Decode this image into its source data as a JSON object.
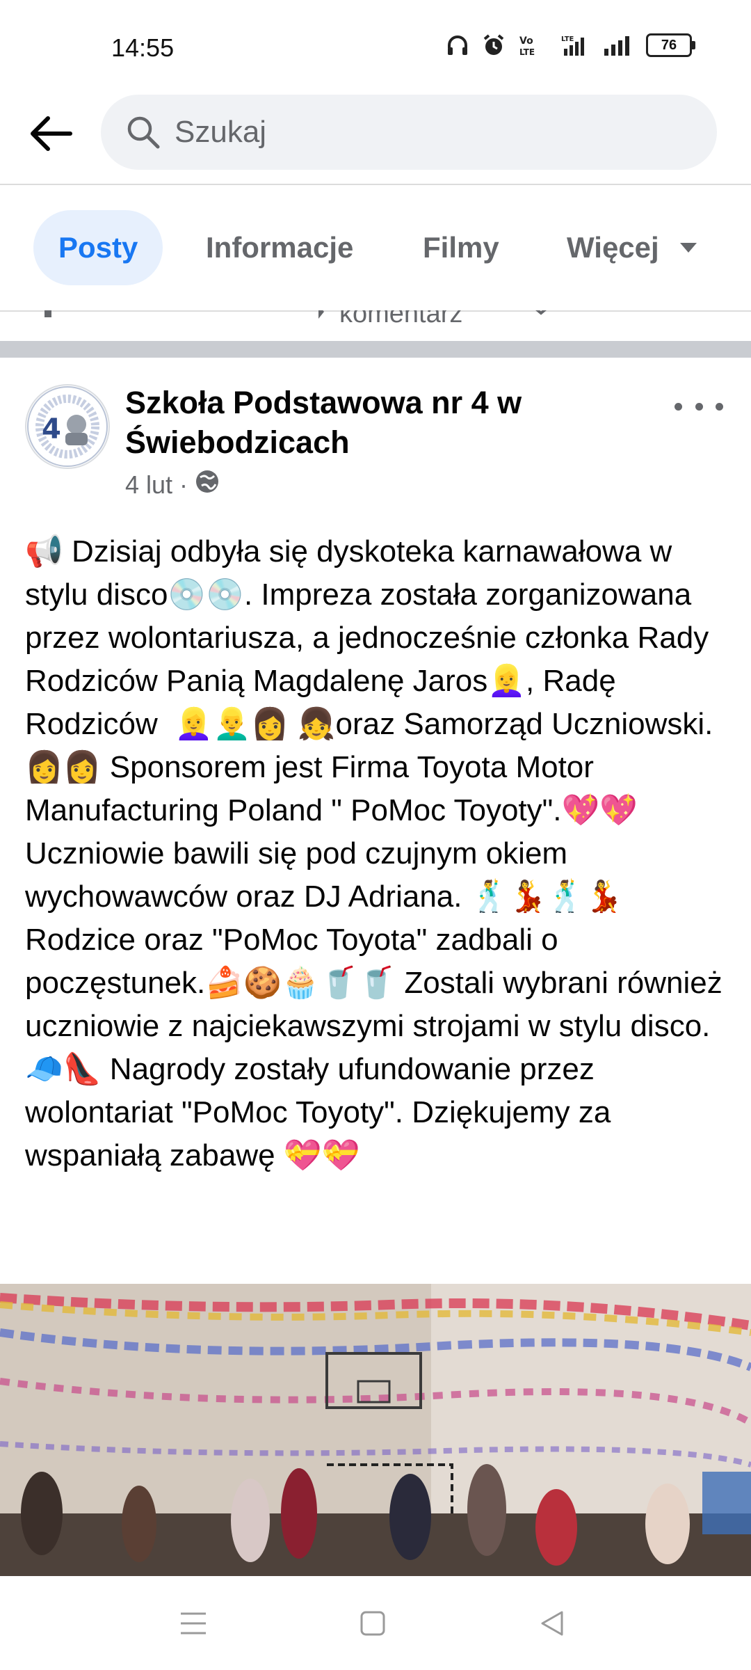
{
  "status_bar": {
    "time": "14:55",
    "battery": "76"
  },
  "search": {
    "placeholder": "Szukaj"
  },
  "tabs": [
    {
      "label": "Posty",
      "active": true
    },
    {
      "label": "Informacje",
      "active": false
    },
    {
      "label": "Filmy",
      "active": false
    },
    {
      "label": "Więcej",
      "active": false
    }
  ],
  "previous_post": {
    "comment_label": "komentarz"
  },
  "post": {
    "author": "Szkoła Podstawowa nr 4 w Świebodzicach",
    "date": "4 lut",
    "privacy_icon": "globe-icon",
    "text": "📢 Dzisiaj odbyła się dyskoteka karnawałowa w stylu disco💿💿. Impreza została zorganizowana przez wolontariusza, a jednocześnie członka Rady Rodziców Panią Magdalenę Jaros👱‍♀️, Radę Rodziców  👱‍♀️👱‍♂️👩 👧oraz Samorząd Uczniowski.👩👩 Sponsorem jest Firma Toyota Motor Manufacturing Poland \" PoMoc Toyoty\".💖💖 Uczniowie bawili się pod czujnym okiem wychowawców oraz DJ Adriana. 🕺💃🕺💃 Rodzice oraz \"PoMoc Toyota\" zadbali o poczęstunek.🍰🍪🧁🥤🥤 Zostali wybrani również uczniowie z najciekawszymi strojami w stylu disco.🧢👠 Nagrody zostały ufundowanie przez wolontariat \"PoMoc Toyoty\". Dziękujemy za wspaniałą zabawę 💝💝"
  },
  "colors": {
    "accent": "#1877f2",
    "tab_active_bg": "#e7f0fd",
    "secondary_text": "#65676b",
    "divider": "#c9ccd1"
  }
}
